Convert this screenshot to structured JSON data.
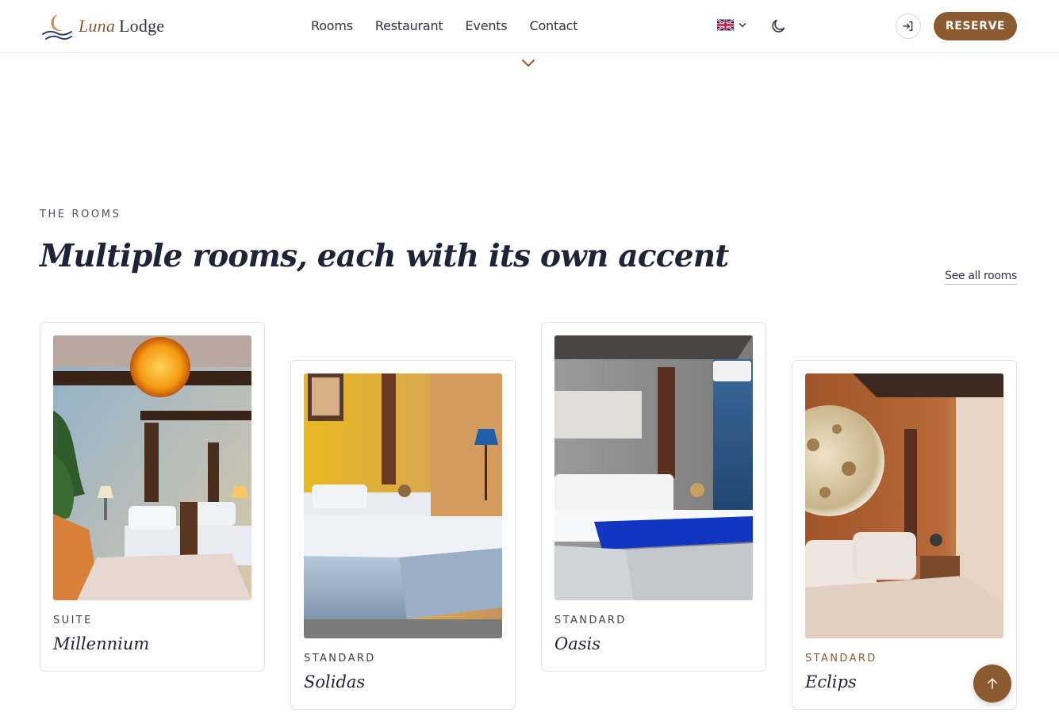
{
  "brand": {
    "name_italic": "Luna",
    "name_regular": "Lodge",
    "accent": "#8b5a2e"
  },
  "nav": {
    "items": [
      {
        "label": "Rooms"
      },
      {
        "label": "Restaurant"
      },
      {
        "label": "Events"
      },
      {
        "label": "Contact"
      }
    ]
  },
  "header": {
    "language_icon": "uk-flag-icon",
    "theme_icon": "moon-icon",
    "login_icon": "sign-in-icon",
    "reserve_label": "RESERVE"
  },
  "section": {
    "eyebrow": "THE ROOMS",
    "title": "Multiple rooms, each with its own accent",
    "see_all": "See all rooms"
  },
  "rooms": [
    {
      "category": "SUITE",
      "name": "Millennium"
    },
    {
      "category": "STANDARD",
      "name": "Solidas"
    },
    {
      "category": "STANDARD",
      "name": "Oasis"
    },
    {
      "category": "STANDARD",
      "name": "Eclips"
    }
  ],
  "scroll_top_icon": "arrow-up-icon"
}
